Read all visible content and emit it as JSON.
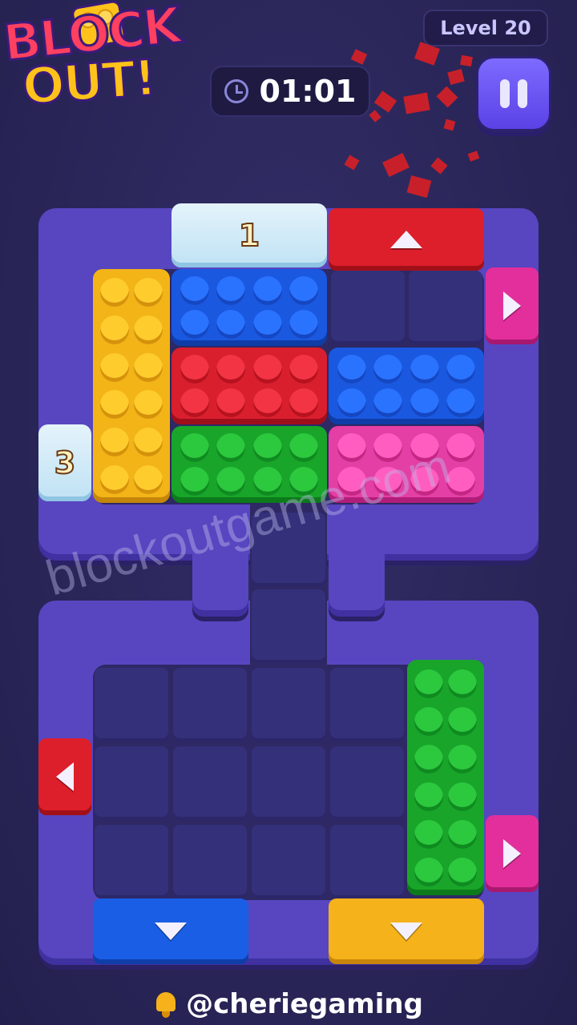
{
  "header": {
    "logo_line1": "BLOCK",
    "logo_line2": "OUT!",
    "level_label": "Level 20",
    "timer": "01:01"
  },
  "board": {
    "ice_blocks": [
      {
        "name": "ice-block-1",
        "count": "1"
      },
      {
        "name": "ice-block-3",
        "count": "3"
      }
    ],
    "colors": {
      "blue": "#1a58e0",
      "red": "#d91f2e",
      "yellow": "#f2b417",
      "green": "#18a52a",
      "pink": "#e43fa5",
      "frame": "#5746c0"
    },
    "gates": [
      {
        "name": "red-gate-top",
        "arrow": "up"
      },
      {
        "name": "pink-gate-right-top",
        "arrow": "right"
      },
      {
        "name": "red-gate-left",
        "arrow": "left"
      },
      {
        "name": "pink-gate-right-bottom",
        "arrow": "right"
      },
      {
        "name": "blue-gate-bottom",
        "arrow": "down"
      },
      {
        "name": "yellow-gate-bottom",
        "arrow": "down"
      }
    ]
  },
  "watermark": "blockoutgame.com",
  "footer": {
    "handle": "@cheriegaming"
  }
}
